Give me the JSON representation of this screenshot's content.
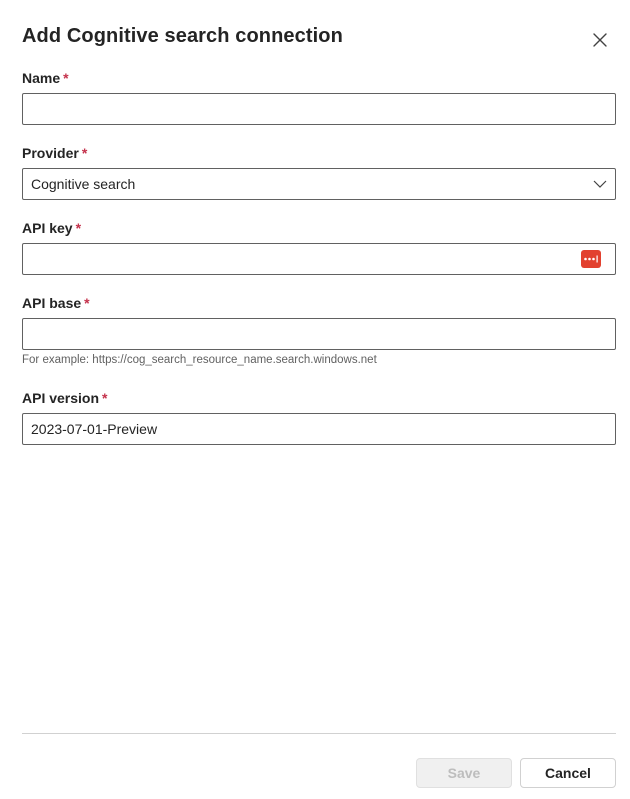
{
  "dialog": {
    "title": "Add Cognitive search connection"
  },
  "fields": {
    "name": {
      "label": "Name",
      "required_mark": "*",
      "value": ""
    },
    "provider": {
      "label": "Provider",
      "required_mark": "*",
      "value": "Cognitive search"
    },
    "api_key": {
      "label": "API key",
      "required_mark": "*",
      "value": ""
    },
    "api_base": {
      "label": "API base",
      "required_mark": "*",
      "value": "",
      "hint": "For example: https://cog_search_resource_name.search.windows.net"
    },
    "api_version": {
      "label": "API version",
      "required_mark": "*",
      "value": "2023-07-01-Preview"
    }
  },
  "footer": {
    "save_label": "Save",
    "cancel_label": "Cancel"
  },
  "icons": {
    "close": "close-icon",
    "dropdown": "chevron-down-icon",
    "password_manager": "password-manager-icon"
  },
  "colors": {
    "required": "#c4314b",
    "password_badge": "#e2412f",
    "disabled_text": "#bdbdbd"
  }
}
